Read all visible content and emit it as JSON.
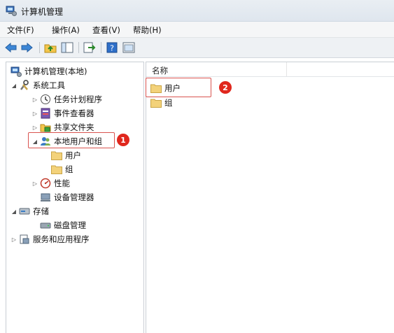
{
  "window": {
    "title": "计算机管理"
  },
  "menu": {
    "items": [
      "文件(F)",
      "操作(A)",
      "查看(V)",
      "帮助(H)"
    ]
  },
  "toolbar": {
    "buttons": [
      "back-arrow-icon",
      "forward-arrow-icon",
      "up-folder-icon",
      "show-hide-tree-icon",
      "export-list-icon",
      "help-icon",
      "properties-icon"
    ]
  },
  "tree": {
    "root": "计算机管理(本地)",
    "system_tools": "系统工具",
    "task_scheduler": "任务计划程序",
    "event_viewer": "事件查看器",
    "shared_folders": "共享文件夹",
    "local_users_groups": "本地用户和组",
    "users": "用户",
    "groups": "组",
    "performance": "性能",
    "device_manager": "设备管理器",
    "storage": "存储",
    "disk_management": "磁盘管理",
    "services_apps": "服务和应用程序"
  },
  "list": {
    "column_name": "名称",
    "items": [
      "用户",
      "组"
    ]
  },
  "annotations": {
    "badge1": "1",
    "badge2": "2"
  },
  "colors": {
    "highlight": "#d9534f",
    "badge": "#e0271d",
    "folder": "#f3d27a"
  }
}
